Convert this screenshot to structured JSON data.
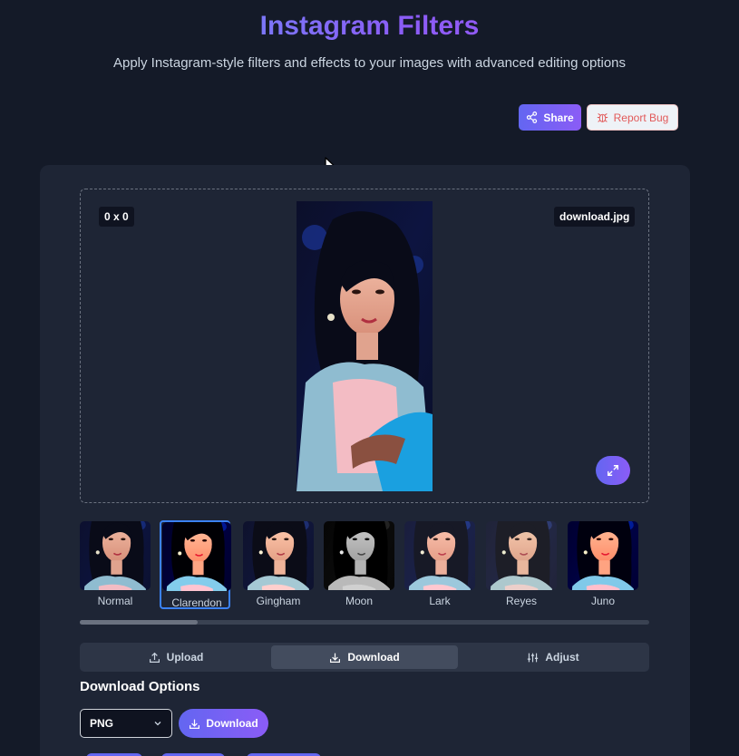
{
  "header": {
    "title": "Instagram Filters",
    "subtitle": "Apply Instagram-style filters and effects to your images with advanced editing options",
    "share_label": "Share",
    "report_label": "Report Bug"
  },
  "preview": {
    "dimensions": "0 x 0",
    "filename": "download.jpg"
  },
  "filters": [
    {
      "label": "Normal",
      "selected": false
    },
    {
      "label": "Clarendon",
      "selected": true
    },
    {
      "label": "Gingham",
      "selected": false
    },
    {
      "label": "Moon",
      "selected": false
    },
    {
      "label": "Lark",
      "selected": false
    },
    {
      "label": "Reyes",
      "selected": false
    },
    {
      "label": "Juno",
      "selected": false
    }
  ],
  "tabs": [
    {
      "label": "Upload",
      "icon": "upload-icon",
      "active": false
    },
    {
      "label": "Download",
      "icon": "download-icon",
      "active": true
    },
    {
      "label": "Adjust",
      "icon": "sliders-icon",
      "active": false
    }
  ],
  "download_options": {
    "title": "Download Options",
    "format_value": "PNG",
    "download_label": "Download"
  },
  "colors": {
    "accent": "#6366f1",
    "accent2": "#8b5cf6",
    "background": "#141a28",
    "card": "#1e2535",
    "selected_border": "#3b82f6"
  }
}
